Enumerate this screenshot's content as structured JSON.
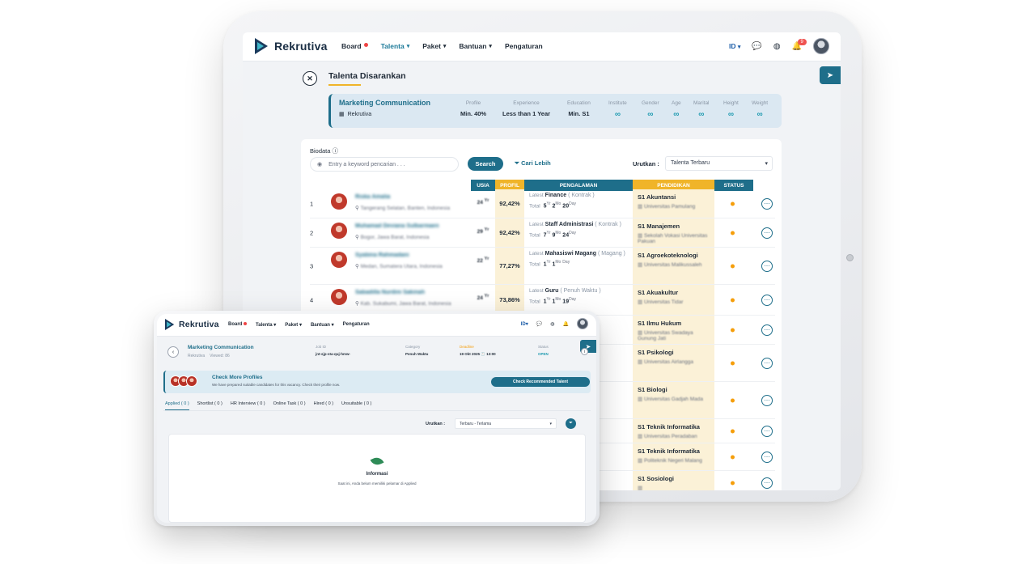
{
  "tablet": {
    "brand": "Rekrutiva",
    "menu": [
      "Board",
      "Talenta",
      "Paket",
      "Bantuan",
      "Pengaturan"
    ],
    "lang": "ID",
    "notif_count": "9",
    "title": "Talenta Disarankan",
    "job": {
      "name": "Marketing Communication",
      "company": "Rekrutiva",
      "requirements": [
        {
          "key": "Profile",
          "value": "Min. 40%"
        },
        {
          "key": "Experience",
          "value": "Less than 1 Year"
        },
        {
          "key": "Education",
          "value": "Min. S1"
        },
        {
          "key": "Institute",
          "value": "∞"
        },
        {
          "key": "Gender",
          "value": "∞"
        },
        {
          "key": "Age",
          "value": "∞"
        },
        {
          "key": "Marital",
          "value": "∞"
        },
        {
          "key": "Height",
          "value": "∞"
        },
        {
          "key": "Weight",
          "value": "∞"
        }
      ]
    },
    "biodata_label": "Biodata",
    "search_placeholder": "Entry a keyword pencarian . . .",
    "search_button": "Search",
    "cari_lebih": "Cari Lebih",
    "sort_label": "Urutkan :",
    "sort_value": "Talenta Terbaru",
    "columns": [
      "USIA",
      "PROFIL",
      "PENGALAMAN",
      "PENDIDIKAN",
      "STATUS"
    ],
    "rows": [
      {
        "no": "1",
        "name": "Riska Amalia",
        "loc": "Tangerang Selatan, Banten, Indonesia",
        "age": "24",
        "profil": "92,42%",
        "position": "Finance",
        "employment": "( Kontrak )",
        "latest": "Latest",
        "total_label": "Total",
        "t_yr": "5",
        "t_mo": "2",
        "t_day": "20",
        "degree": "S1 Akuntansi",
        "uni": "Universitas Pamulang"
      },
      {
        "no": "2",
        "name": "Muhamad Deviana Sulbarmaen",
        "loc": "Bogor, Jawa Barat, Indonesia",
        "age": "29",
        "profil": "92,42%",
        "position": "Staff Administrasi",
        "employment": "( Kontrak )",
        "latest": "Latest",
        "total_label": "Total",
        "t_yr": "7",
        "t_mo": "9",
        "t_day": "24",
        "degree": "S1 Manajemen",
        "uni": "Sekolah Vokasi Universitas Pakuan"
      },
      {
        "no": "3",
        "name": "Syabina Rahmadani",
        "loc": "Medan, Sumatera Utara, Indonesia",
        "age": "22",
        "profil": "77,27%",
        "position": "Mahasiswi Magang",
        "employment": "( Magang )",
        "latest": "Latest",
        "total_label": "Total",
        "t_yr": "1",
        "t_mo": "1",
        "t_day": "",
        "degree": "S1 Agroekoteknologi",
        "uni": "Universitas Malikussaleh"
      },
      {
        "no": "4",
        "name": "Sabadilla Nurdini Sakinah",
        "loc": "Kab. Sukabumi, Jawa Barat, Indonesia",
        "age": "24",
        "profil": "73,86%",
        "position": "Guru",
        "employment": "( Penuh Waktu )",
        "latest": "Latest",
        "total_label": "Total",
        "t_yr": "1",
        "t_mo": "1",
        "t_day": "19",
        "degree": "S1 Akuakultur",
        "uni": "Universitas Tidar"
      },
      {
        "no": "",
        "name": "",
        "loc": "",
        "age": "",
        "profil": "",
        "position": "",
        "employment": "",
        "latest": "",
        "total_label": "",
        "t_yr": "",
        "t_mo": "",
        "t_day": "",
        "degree": "S1 Ilmu Hukum",
        "uni": "Universitas Swadaya Gunung Jati"
      },
      {
        "no": "",
        "name": "",
        "loc": "",
        "age": "",
        "profil": "",
        "position": "asional (",
        "employment": "",
        "latest": "",
        "total_label": "",
        "t_yr": "",
        "t_mo": "",
        "t_day": "",
        "degree": "S1 Psikologi",
        "uni": "Universitas Airlangga"
      },
      {
        "no": "",
        "name": "",
        "loc": "",
        "age": "",
        "profil": "",
        "position": "tif dan CS",
        "employment": "",
        "latest": "",
        "total_label": "",
        "t_yr": "",
        "t_mo": "",
        "t_day": "",
        "degree": "S1 Biologi",
        "uni": "Universitas Gadjah Mada"
      },
      {
        "no": "",
        "name": "",
        "loc": "",
        "age": "",
        "profil": "",
        "position": "",
        "employment": "",
        "latest": "",
        "total_label": "",
        "t_yr": "",
        "t_mo": "",
        "t_day": "",
        "degree": "S1 Teknik Informatika",
        "uni": "Universitas Peradaban"
      },
      {
        "no": "",
        "name": "",
        "loc": "",
        "age": "",
        "profil": "",
        "position": "gang )",
        "employment": "",
        "latest": "",
        "total_label": "",
        "t_yr": "",
        "t_mo": "",
        "t_day": "",
        "degree": "S1 Teknik Informatika",
        "uni": "Politeknik Negeri Malang"
      },
      {
        "no": "",
        "name": "",
        "loc": "",
        "age": "",
        "profil": "",
        "position": "",
        "employment": "",
        "latest": "",
        "total_label": "",
        "t_yr": "",
        "t_mo": "",
        "t_day": "",
        "degree": "S1 Sosiologi",
        "uni": ""
      }
    ],
    "units": {
      "yr": "Yr",
      "mo": "Mo",
      "day": "Day"
    }
  },
  "laptop": {
    "brand": "Rekrutiva",
    "menu": [
      "Board",
      "Talenta",
      "Paket",
      "Bantuan",
      "Pengaturan"
    ],
    "lang": "ID",
    "job_name": "Marketing Communication",
    "company": "Rekrutiva",
    "viewed": "Viewed: 86",
    "job_id_label": "Job ID",
    "job_id": "jnt-sjp-sta-quj-hmw-",
    "category_label": "Category",
    "category": "Penuh Waktu",
    "deadline_label": "Deadline",
    "deadline": "19 Okt 2025 🕑 13:00",
    "status_label": "Status",
    "status": "OPEN",
    "check_title": "Check More Profiles",
    "check_sub": "We have prepared suitable candidates for this vacancy. Check their profile now.",
    "check_button": "Check Recommended Talent",
    "tabs": [
      "Applied ( 0 )",
      "Shortlist ( 0 )",
      "HR Interview ( 0 )",
      "Online Task ( 0 )",
      "Hired ( 0 )",
      "Unsuitable ( 0 )"
    ],
    "sort_label": "Urutkan :",
    "sort_value": "Terbaru - Terlama",
    "empty_title": "Informasi",
    "empty_text": "Saat ini, Anda belum memiliki pelamar di Applied"
  }
}
